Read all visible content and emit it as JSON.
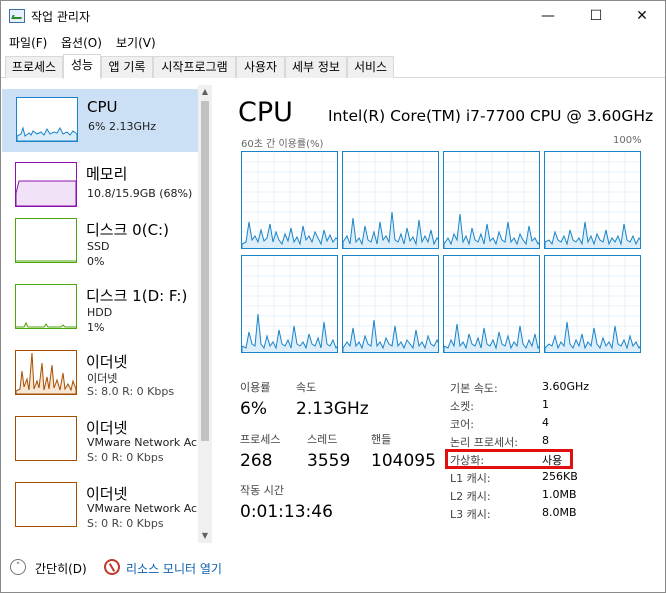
{
  "titlebar": {
    "title": "작업 관리자",
    "minimize": "—",
    "maximize": "☐",
    "close": "✕"
  },
  "menu": [
    {
      "label": "파일(F)"
    },
    {
      "label": "옵션(O)"
    },
    {
      "label": "보기(V)"
    }
  ],
  "tabs": [
    {
      "label": "프로세스",
      "active": false
    },
    {
      "label": "성능",
      "active": true
    },
    {
      "label": "앱 기록",
      "active": false
    },
    {
      "label": "시작프로그램",
      "active": false
    },
    {
      "label": "사용자",
      "active": false
    },
    {
      "label": "세부 정보",
      "active": false
    },
    {
      "label": "서비스",
      "active": false
    }
  ],
  "sidebar": {
    "items": [
      {
        "title": "CPU",
        "line1": "6% 2.13GHz",
        "line2": "",
        "color": "#1a84c9"
      },
      {
        "title": "메모리",
        "line1": "10.8/15.9GB (68%)",
        "line2": "",
        "color": "#8b12ae"
      },
      {
        "title": "디스크 0(C:)",
        "line1": "SSD",
        "line2": "0%",
        "color": "#4da60c"
      },
      {
        "title": "디스크 1(D: F:)",
        "line1": "HDD",
        "line2": "1%",
        "color": "#4da60c"
      },
      {
        "title": "이더넷",
        "line1": "이더넷",
        "line2": "S: 8.0 R: 0 Kbps",
        "color": "#a74f01"
      },
      {
        "title": "이더넷",
        "line1": "VMware Network Ac",
        "line2": "S: 0 R: 0 Kbps",
        "color": "#a74f01"
      },
      {
        "title": "이더넷",
        "line1": "VMware Network Ac",
        "line2": "S: 0 R: 0 Kbps",
        "color": "#a74f01"
      }
    ]
  },
  "main": {
    "title": "CPU",
    "model": "Intel(R) Core(TM) i7-7700 CPU @ 3.60GHz",
    "graph_label_left": "60초 간 이용률(%)",
    "graph_label_right": "100%",
    "stats": {
      "util_label": "이용률",
      "util_value": "6%",
      "speed_label": "속도",
      "speed_value": "2.13GHz",
      "proc_label": "프로세스",
      "proc_value": "268",
      "thread_label": "스레드",
      "thread_value": "3559",
      "handle_label": "핸들",
      "handle_value": "104095",
      "uptime_label": "작동 시간",
      "uptime_value": "0:01:13:46"
    },
    "details": [
      {
        "key": "기본 속도:",
        "value": "3.60GHz"
      },
      {
        "key": "소켓:",
        "value": "1"
      },
      {
        "key": "코어:",
        "value": "4"
      },
      {
        "key": "논리 프로세서:",
        "value": "8"
      },
      {
        "key": "가상화:",
        "value": "사용"
      },
      {
        "key": "L1 캐시:",
        "value": "256KB"
      },
      {
        "key": "L2 캐시:",
        "value": "1.0MB"
      },
      {
        "key": "L3 캐시:",
        "value": "8.0MB"
      }
    ]
  },
  "footer": {
    "collapse_label": "간단히(D)",
    "resmon_label": "리소스 모니터 열기"
  },
  "colors": {
    "accent": "#1a84c9",
    "highlight": "#e10f10",
    "selection": "#cce0f5"
  }
}
